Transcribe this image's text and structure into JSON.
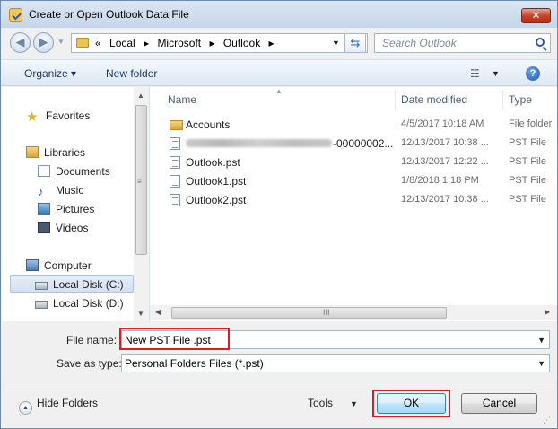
{
  "window": {
    "title": "Create or Open Outlook Data File",
    "close_label": "✕"
  },
  "address": {
    "prefix": "«",
    "crumbs": [
      "Local",
      "Microsoft",
      "Outlook"
    ],
    "separator": "▸",
    "search_placeholder": "Search Outlook"
  },
  "toolbar": {
    "organize_label": "Organize ▾",
    "new_folder_label": "New folder",
    "views_glyph": "☷",
    "help_glyph": "?"
  },
  "nav": {
    "favorites": "Favorites",
    "libraries": "Libraries",
    "documents": "Documents",
    "music": "Music",
    "pictures": "Pictures",
    "videos": "Videos",
    "computer": "Computer",
    "local_c": "Local Disk (C:)",
    "local_d": "Local Disk (D:)"
  },
  "columns": {
    "name": "Name",
    "date_modified": "Date modified",
    "type": "Type"
  },
  "files": [
    {
      "name": "Accounts",
      "date": "4/5/2017 10:18 AM",
      "type": "File folder",
      "icon": "folder-icon"
    },
    {
      "name": "-00000002...",
      "date": "12/13/2017 10:38 ...",
      "type": "PST File",
      "icon": "pst-file-icon",
      "redacted_prefix": true
    },
    {
      "name": "Outlook.pst",
      "date": "12/13/2017 12:22 ...",
      "type": "PST File",
      "icon": "pst-file-icon"
    },
    {
      "name": "Outlook1.pst",
      "date": "1/8/2018 1:18 PM",
      "type": "PST File",
      "icon": "pst-file-icon"
    },
    {
      "name": "Outlook2.pst",
      "date": "12/13/2017 10:38 ...",
      "type": "PST File",
      "icon": "pst-file-icon"
    }
  ],
  "hscroll_grip": "III",
  "form": {
    "file_name_label": "File name:",
    "file_name_value": "New PST File .pst",
    "save_as_label": "Save as type:",
    "save_as_value": "Personal Folders Files (*.pst)"
  },
  "footer": {
    "hide_folders": "Hide Folders",
    "tools": "Tools",
    "ok": "OK",
    "cancel": "Cancel"
  },
  "colors": {
    "highlight": "#e01b1b",
    "ok_button": "#3c7fb1"
  }
}
